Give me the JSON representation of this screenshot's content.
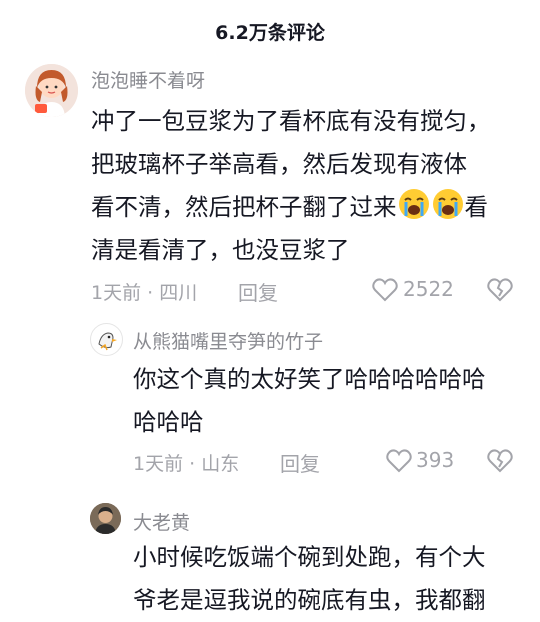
{
  "header": {
    "title": "6.2万条评论"
  },
  "comments": [
    {
      "user": "泡泡睡不着呀",
      "lines": [
        "冲了一包豆浆为了看杯底有没有搅匀，",
        "把玻璃杯子举高看，然后发现有液体",
        "看不清，然后把杯子翻了过来",
        "看",
        "清是看清了，也没豆浆了"
      ],
      "meta": "1天前 · 四川",
      "reply": "回复",
      "likes": "2522",
      "emoji": "loudly-crying-face"
    },
    {
      "user": "从熊猫嘴里夺笋的竹子",
      "lines": [
        "你这个真的太好笑了哈哈哈哈哈哈",
        "哈哈哈"
      ],
      "meta": "1天前 · 山东",
      "reply": "回复",
      "likes": "393"
    },
    {
      "user": "大老黄",
      "lines": [
        "小时候吃饭端个碗到处跑，有个大",
        "爷老是逗我说的碗底有虫，我都翻"
      ]
    }
  ],
  "colors": {
    "text": "#161823",
    "secondary": "#a3a4aa",
    "username": "#8a8b91"
  },
  "icons": [
    "heart-outline-icon",
    "heart-broken-icon",
    "avatar-icon"
  ]
}
